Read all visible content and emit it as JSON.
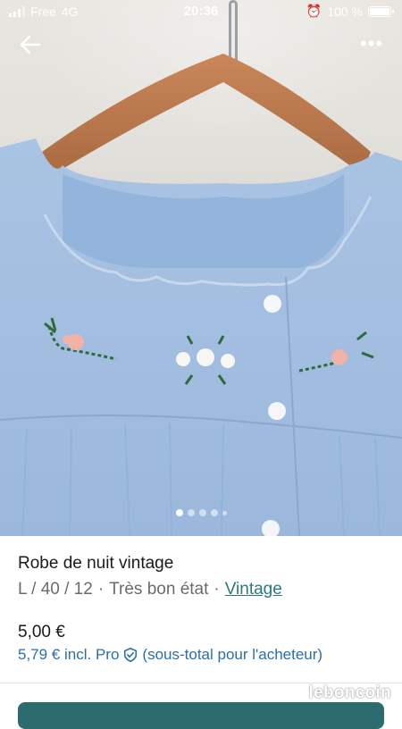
{
  "status_bar": {
    "carrier": "Free",
    "network": "4G",
    "time": "20:36",
    "battery": "100 %"
  },
  "nav": {
    "back_icon": "arrow-left-icon",
    "more_icon": "more-horizontal-icon",
    "more_label": "•••"
  },
  "gallery": {
    "photo_count": 5,
    "active_index": 0
  },
  "listing": {
    "title": "Robe de nuit vintage",
    "size_info": "L / 40 / 12",
    "separator": "·",
    "condition": "Très bon état",
    "style_link": "Vintage",
    "price": "5,00 €",
    "pro_price": "5,79 € incl. Pro",
    "pro_note": "(sous-total pour l'acheteur)"
  },
  "watermark": "leboncoin",
  "colors": {
    "accent": "#2b7a78",
    "cta": "#2c6c6f",
    "pro_blue": "#2b6fa8"
  }
}
